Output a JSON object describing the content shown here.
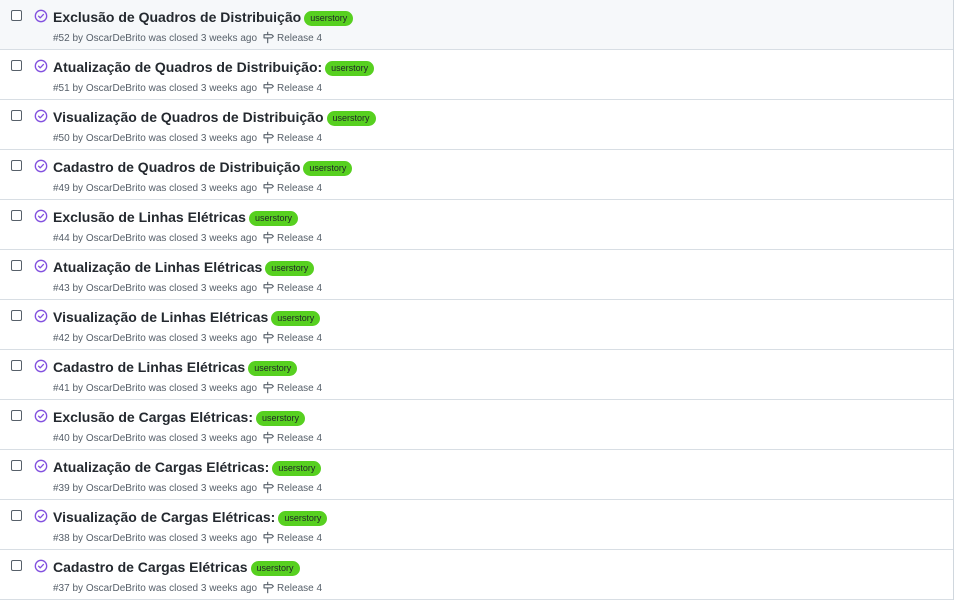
{
  "colors": {
    "label_bg": "#57d020",
    "closed_icon": "#8250df",
    "meta_text": "#57606a"
  },
  "icons": {
    "state": "check-circle-icon",
    "milestone": "milestone-icon"
  },
  "issues": [
    {
      "title": "Exclusão de Quadros de Distribuição",
      "label": "userstory",
      "number": "#52",
      "by": "by",
      "author": "OscarDeBrito",
      "status": "was closed 3 weeks ago",
      "milestone": "Release 4"
    },
    {
      "title": "Atualização de Quadros de Distribuição:",
      "label": "userstory",
      "number": "#51",
      "by": "by",
      "author": "OscarDeBrito",
      "status": "was closed 3 weeks ago",
      "milestone": "Release 4"
    },
    {
      "title": "Visualização de Quadros de Distribuição",
      "label": "userstory",
      "number": "#50",
      "by": "by",
      "author": "OscarDeBrito",
      "status": "was closed 3 weeks ago",
      "milestone": "Release 4"
    },
    {
      "title": "Cadastro de Quadros de Distribuição",
      "label": "userstory",
      "number": "#49",
      "by": "by",
      "author": "OscarDeBrito",
      "status": "was closed 3 weeks ago",
      "milestone": "Release 4"
    },
    {
      "title": "Exclusão de Linhas Elétricas",
      "label": "userstory",
      "number": "#44",
      "by": "by",
      "author": "OscarDeBrito",
      "status": "was closed 3 weeks ago",
      "milestone": "Release 4"
    },
    {
      "title": "Atualização de Linhas Elétricas",
      "label": "userstory",
      "number": "#43",
      "by": "by",
      "author": "OscarDeBrito",
      "status": "was closed 3 weeks ago",
      "milestone": "Release 4"
    },
    {
      "title": "Visualização de Linhas Elétricas",
      "label": "userstory",
      "number": "#42",
      "by": "by",
      "author": "OscarDeBrito",
      "status": "was closed 3 weeks ago",
      "milestone": "Release 4"
    },
    {
      "title": "Cadastro de Linhas Elétricas",
      "label": "userstory",
      "number": "#41",
      "by": "by",
      "author": "OscarDeBrito",
      "status": "was closed 3 weeks ago",
      "milestone": "Release 4"
    },
    {
      "title": "Exclusão de Cargas Elétricas:",
      "label": "userstory",
      "number": "#40",
      "by": "by",
      "author": "OscarDeBrito",
      "status": "was closed 3 weeks ago",
      "milestone": "Release 4"
    },
    {
      "title": "Atualização de Cargas Elétricas:",
      "label": "userstory",
      "number": "#39",
      "by": "by",
      "author": "OscarDeBrito",
      "status": "was closed 3 weeks ago",
      "milestone": "Release 4"
    },
    {
      "title": "Visualização de Cargas Elétricas:",
      "label": "userstory",
      "number": "#38",
      "by": "by",
      "author": "OscarDeBrito",
      "status": "was closed 3 weeks ago",
      "milestone": "Release 4"
    },
    {
      "title": "Cadastro de Cargas Elétricas",
      "label": "userstory",
      "number": "#37",
      "by": "by",
      "author": "OscarDeBrito",
      "status": "was closed 3 weeks ago",
      "milestone": "Release 4"
    }
  ]
}
